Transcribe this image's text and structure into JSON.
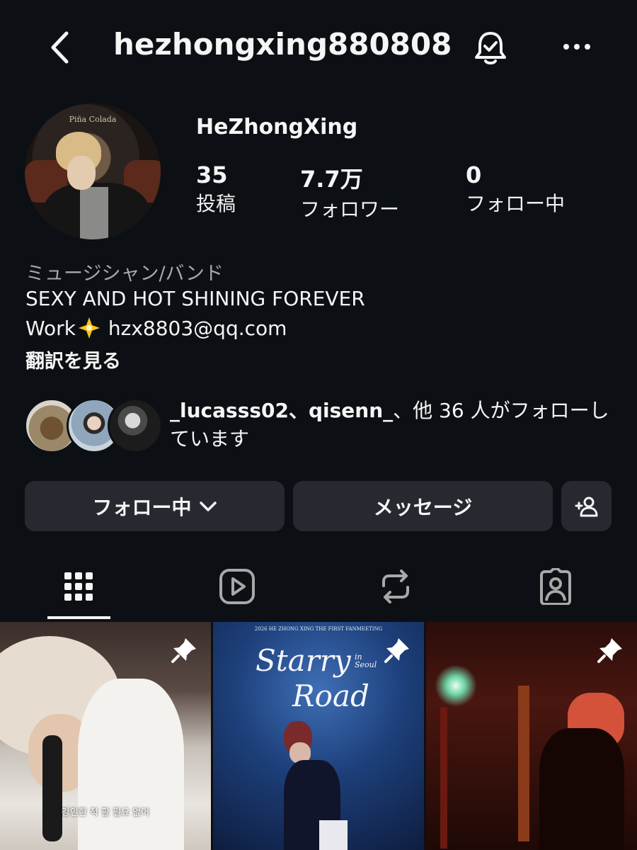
{
  "header": {
    "username": "hezhongxing880808",
    "back_icon": "chevron-left-icon",
    "bell_icon": "notification-bell-check-icon",
    "more_icon": "more-horizontal-icon"
  },
  "profile": {
    "display_name": "HeZhongXing",
    "avatar_caption": "Piña Colada",
    "stats": [
      {
        "value": "35",
        "label": "投稿"
      },
      {
        "value": "7.7万",
        "label": "フォロワー"
      },
      {
        "value": "0",
        "label": "フォロー中"
      }
    ],
    "category": "ミュージシャン/バンド",
    "bio_line1": "SEXY AND HOT SHINING FOREVER",
    "bio_work_prefix": "Work",
    "bio_work_email": "hzx8803@qq.com",
    "see_translation": "翻訳を見る"
  },
  "mutuals": {
    "names": "_lucasss02、qisenn_",
    "rest": "、他 36 人がフォローしています"
  },
  "actions": {
    "following_label": "フォロー中",
    "message_label": "メッセージ",
    "add_person_icon": "add-person-icon"
  },
  "tabs": [
    {
      "name": "grid",
      "icon": "grid-icon",
      "active": true
    },
    {
      "name": "reels",
      "icon": "reels-icon",
      "active": false
    },
    {
      "name": "reposts",
      "icon": "repost-icon",
      "active": false
    },
    {
      "name": "tagged",
      "icon": "tagged-person-icon",
      "active": false
    }
  ],
  "posts": [
    {
      "caption": "강인한 척 할 필요 없어",
      "pinned": true
    },
    {
      "header": "2026 HE ZHONG XING THE FIRST FANMEETING",
      "title_line1": "Starry",
      "title_small": "in Seoul",
      "title_line2": "Road",
      "pinned": true
    },
    {
      "pinned": true
    }
  ],
  "colors": {
    "background": "#0c1014",
    "button": "#262a30",
    "text": "#f5f5f5",
    "muted_text": "#a8a8a8"
  }
}
